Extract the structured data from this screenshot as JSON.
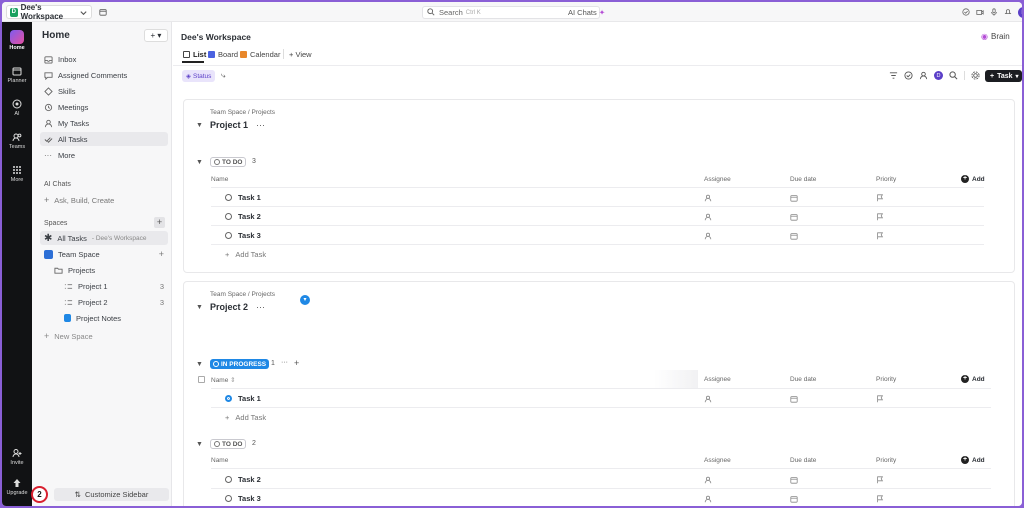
{
  "topbar": {
    "workspace": "Dee's Workspace",
    "ws_badge": "D",
    "search_placeholder": "Search",
    "search_hint": "Ctrl K",
    "ai_chats": "AI Chats",
    "user_initial": "D"
  },
  "rail": {
    "items": [
      "Home",
      "Planner",
      "AI",
      "Teams",
      "More"
    ],
    "bottom": [
      "Invite",
      "Upgrade"
    ],
    "notification_count": "2"
  },
  "sidebar": {
    "title": "Home",
    "nav": [
      "Inbox",
      "Assigned Comments",
      "Skills",
      "Meetings",
      "My Tasks",
      "All Tasks",
      "More"
    ],
    "ai_chats_label": "AI Chats",
    "ai_chats_item": "Ask, Build, Create",
    "spaces_label": "Spaces",
    "all_tasks": "All Tasks",
    "all_tasks_sub": "- Dee's Workspace",
    "team_space": "Team Space",
    "projects_folder": "Projects",
    "lists": [
      {
        "name": "Project 1",
        "count": "3"
      },
      {
        "name": "Project 2",
        "count": "3"
      },
      {
        "name": "Project Notes",
        "count": ""
      }
    ],
    "new_space": "New Space",
    "customize": "Customize Sidebar"
  },
  "main": {
    "title": "Dee's Workspace",
    "brain": "Brain",
    "tabs": [
      "List",
      "Board",
      "Calendar"
    ],
    "add_view": "+ View",
    "status_chip": "Status",
    "task_button": "Task",
    "projects": [
      {
        "crumb": "Team Space / Projects",
        "name": "Project 1",
        "groups": [
          {
            "status": "TO DO",
            "count": "3",
            "tasks": [
              "Task 1",
              "Task 2",
              "Task 3"
            ]
          }
        ]
      },
      {
        "crumb": "Team Space / Projects",
        "name": "Project 2",
        "groups": [
          {
            "status": "IN PROGRESS",
            "count": "1",
            "tasks": [
              "Task 1"
            ]
          },
          {
            "status": "TO DO",
            "count": "2",
            "tasks": [
              "Task 2",
              "Task 3"
            ]
          }
        ]
      }
    ],
    "columns": {
      "name": "Name",
      "assignee": "Assignee",
      "due": "Due date",
      "priority": "Priority",
      "add": "Add"
    },
    "add_task": "Add Task",
    "more_dots": "···"
  },
  "colors": {
    "accent": "#1f88e5",
    "frame": "#8a5fd6",
    "rail": "#111214",
    "sidebar": "#f7f7f8"
  }
}
